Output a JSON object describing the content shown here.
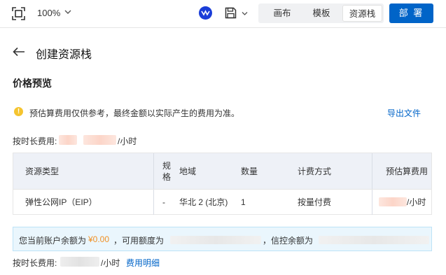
{
  "toolbar": {
    "zoom": "100%",
    "tabs": [
      "画布",
      "模板",
      "资源栈"
    ],
    "active_tab": "资源栈",
    "deploy_label": "部 署"
  },
  "page": {
    "title": "创建资源栈",
    "section_title": "价格预览",
    "notice": "预估算费用仅供参考，最终金额以实际产生的费用为准。",
    "export_label": "导出文件",
    "hourly_label": "按时长费用:",
    "hourly_unit": "/小时"
  },
  "table": {
    "headers": [
      "资源类型",
      "规格",
      "地域",
      "数量",
      "计费方式",
      "预估算费用"
    ],
    "rows": [
      {
        "type": "弹性公网IP（EIP）",
        "spec": "-",
        "region": "华北 2 (北京)",
        "count": "1",
        "billing": "按量付费",
        "fee_unit": "/小时"
      }
    ]
  },
  "balance": {
    "prefix": "您当前账户余额为",
    "amount": "¥0.00",
    "mid": "，可用额度为",
    "credit": "，信控余额为"
  },
  "footer": {
    "hourly_label": "按时长费用:",
    "hourly_unit": "/小时",
    "detail_link": "费用明细"
  },
  "icons": {
    "fit": "fit-screen-icon",
    "logo": "app-logo-icon",
    "save": "save-icon",
    "back": "arrow-left-icon",
    "warning": "warning-icon"
  },
  "colors": {
    "primary": "#0064c8",
    "warning": "#f5c42f",
    "amount": "#f19024"
  }
}
